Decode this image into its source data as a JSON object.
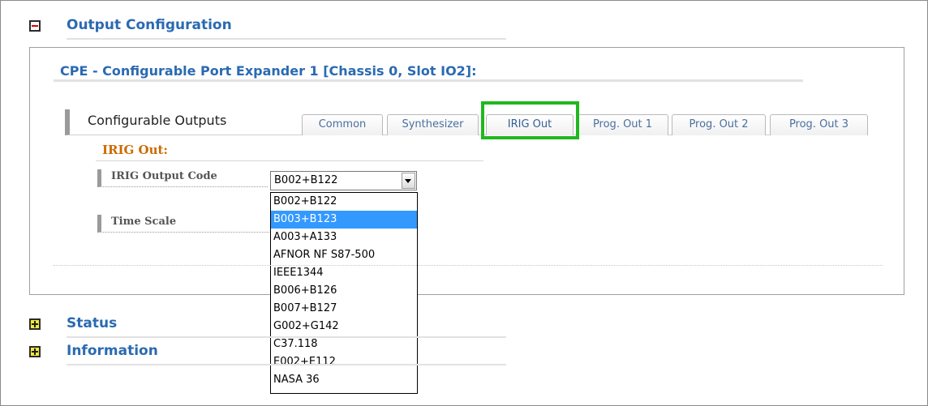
{
  "sections": {
    "output_configuration": {
      "title": "Output Configuration",
      "toggle": "minus-icon"
    },
    "status": {
      "title": "Status",
      "toggle": "plus-icon"
    },
    "information": {
      "title": "Information",
      "toggle": "plus-icon"
    }
  },
  "cpe": {
    "title": "CPE - Configurable Port Expander 1 [Chassis 0, Slot IO2]:"
  },
  "configurable_outputs": {
    "label": "Configurable Outputs",
    "tabs": [
      {
        "label": "Common"
      },
      {
        "label": "Synthesizer"
      },
      {
        "label": "IRIG Out"
      },
      {
        "label": "Prog. Out 1"
      },
      {
        "label": "Prog. Out 2"
      },
      {
        "label": "Prog. Out 3"
      }
    ],
    "active_tab": "IRIG Out"
  },
  "irig_out": {
    "title": "IRIG Out:",
    "fields": {
      "output_code": {
        "label": "IRIG Output Code",
        "value": "B002+B122",
        "options": [
          "B002+B122",
          "B003+B123",
          "A003+A133",
          "AFNOR NF S87-500",
          "IEEE1344",
          "B006+B126",
          "B007+B127",
          "G002+G142",
          "C37.118",
          "E002+E112",
          "NASA 36"
        ],
        "highlighted_option": "B003+B123"
      },
      "time_scale": {
        "label": "Time Scale"
      }
    }
  },
  "colors": {
    "section_title": "#2a6ab2",
    "irig_title": "#cc6a00",
    "tab_text": "#4a6fa0",
    "highlight_box": "#1fb81f",
    "dropdown_selected": "#3399ff"
  }
}
